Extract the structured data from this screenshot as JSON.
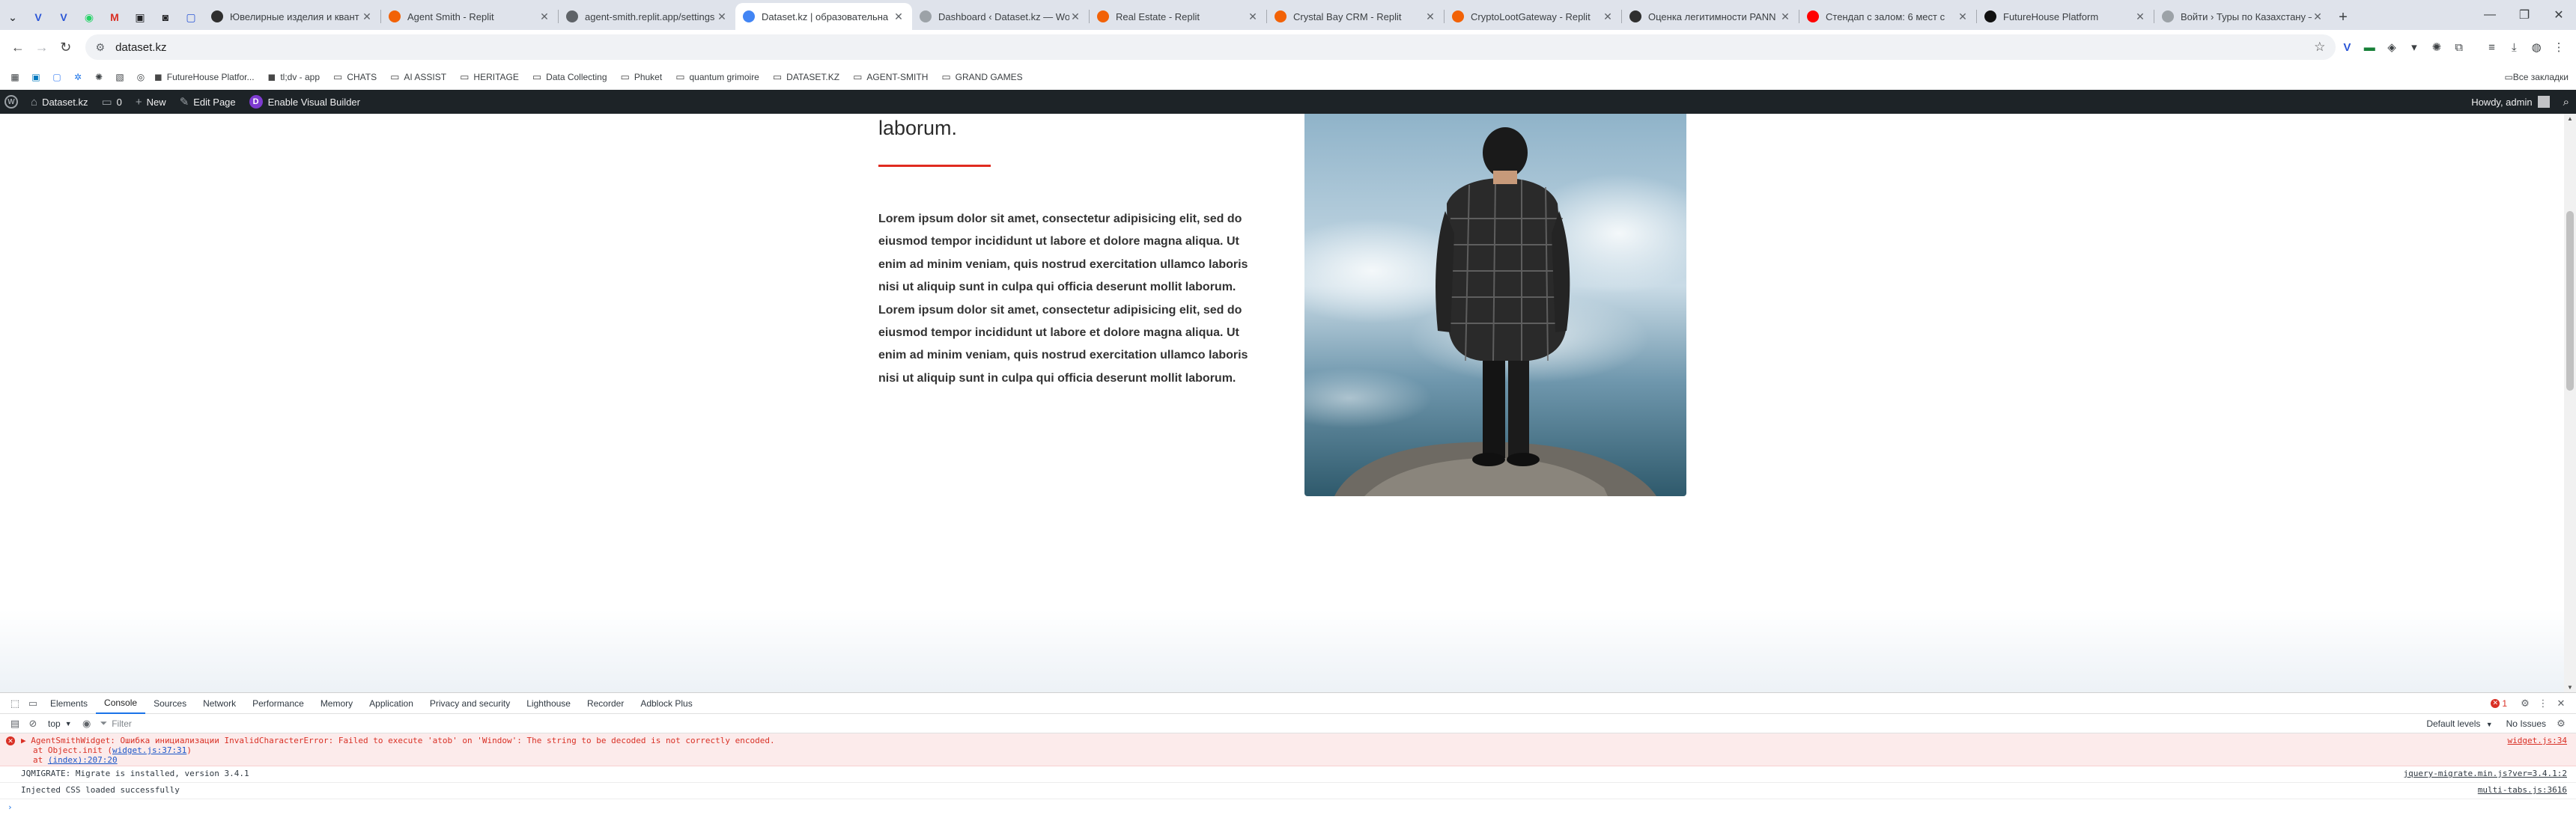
{
  "browser": {
    "tabs": [
      {
        "title": "Ювелирные изделия и квант",
        "fav_color": "#2f2f2f"
      },
      {
        "title": "Agent Smith - Replit",
        "fav_color": "#f26207"
      },
      {
        "title": "agent-smith.replit.app/settings",
        "fav_color": "#5f6368"
      },
      {
        "title": "Dataset.kz | образовательна",
        "fav_color": "#4285f4",
        "active": true
      },
      {
        "title": "Dashboard ‹ Dataset.kz — Wor",
        "fav_color": "#9ca2a7"
      },
      {
        "title": "Real Estate - Replit",
        "fav_color": "#f26207"
      },
      {
        "title": "Crystal Bay CRM - Replit",
        "fav_color": "#f26207"
      },
      {
        "title": "CryptoLootGateway - Replit",
        "fav_color": "#f26207"
      },
      {
        "title": "Оценка легитимности PANN",
        "fav_color": "#2f2f2f"
      },
      {
        "title": "Стендап с залом: 6 мест с",
        "fav_color": "#ff0000"
      },
      {
        "title": "FutureHouse Platform",
        "fav_color": "#111111"
      },
      {
        "title": "Войти › Туры по Казахстану —",
        "fav_color": "#9ca2a7"
      }
    ],
    "url": "dataset.kz",
    "bookmarks": [
      {
        "label": "FutureHouse Platfor...",
        "type": "site"
      },
      {
        "label": "tl;dv - app",
        "type": "site"
      },
      {
        "label": "CHATS",
        "type": "folder"
      },
      {
        "label": "AI ASSIST",
        "type": "folder"
      },
      {
        "label": "HERITAGE",
        "type": "folder"
      },
      {
        "label": "Data Collecting",
        "type": "folder"
      },
      {
        "label": "Phuket",
        "type": "folder"
      },
      {
        "label": "quantum grimoire",
        "type": "folder"
      },
      {
        "label": "DATASET.KZ",
        "type": "folder"
      },
      {
        "label": "AGENT-SMITH",
        "type": "folder"
      },
      {
        "label": "GRAND GAMES",
        "type": "folder"
      }
    ],
    "all_bookmarks": "Все закладки"
  },
  "wpbar": {
    "site": "Dataset.kz",
    "comments": "0",
    "new": "New",
    "edit": "Edit Page",
    "visual_builder": "Enable Visual Builder",
    "howdy": "Howdy, admin"
  },
  "page": {
    "heading": "laborum.",
    "body": "Lorem ipsum dolor sit amet, consectetur adipisicing elit, sed do eiusmod tempor incididunt ut labore et dolore magna aliqua. Ut enim ad minim veniam, quis nostrud exercitation ullamco laboris nisi ut aliquip sunt in culpa qui officia deserunt mollit laborum. Lorem ipsum dolor sit amet, consectetur adipisicing elit, sed do eiusmod tempor incididunt ut labore et dolore magna aliqua. Ut enim ad minim veniam, quis nostrud exercitation ullamco laboris nisi ut aliquip sunt in culpa qui officia deserunt mollit laborum.",
    "accent_color": "#e02b20"
  },
  "devtools": {
    "tabs": [
      "Elements",
      "Console",
      "Sources",
      "Network",
      "Performance",
      "Memory",
      "Application",
      "Privacy and security",
      "Lighthouse",
      "Recorder",
      "Adblock Plus"
    ],
    "active_tab": "Console",
    "error_count": "1",
    "context": "top",
    "filter_placeholder": "Filter",
    "levels": "Default levels",
    "issues": "No Issues",
    "messages": {
      "error_line1": "AgentSmithWidget: Ошибка инициализации InvalidCharacterError: Failed to execute 'atob' on 'Window': The string to be decoded is not correctly encoded.",
      "error_line2_prefix": "at Object.init (",
      "error_line2_link": "widget.js:37:31",
      "error_line2_suffix": ")",
      "error_line3_prefix": "at ",
      "error_line3_link": "(index):207:20",
      "error_src": "widget.js:34",
      "info1": "JQMIGRATE: Migrate is installed, version 3.4.1",
      "info1_src": "jquery-migrate.min.js?ver=3.4.1:2",
      "info2": "Injected CSS loaded successfully",
      "info2_src": "multi-tabs.js:3616"
    }
  }
}
